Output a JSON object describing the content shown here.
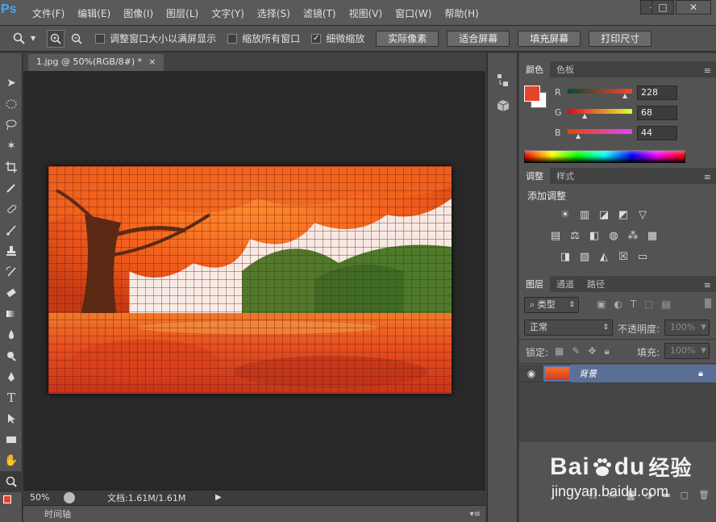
{
  "app": {
    "logo": "Ps"
  },
  "menu": [
    "文件(F)",
    "编辑(E)",
    "图像(I)",
    "图层(L)",
    "文字(Y)",
    "选择(S)",
    "滤镜(T)",
    "视图(V)",
    "窗口(W)",
    "帮助(H)"
  ],
  "window_controls": {
    "minimize": "–",
    "restore": "□",
    "close": "✕"
  },
  "options": {
    "resize_windows": "调整窗口大小以满屏显示",
    "zoom_all": "缩放所有窗口",
    "scrubby_zoom": "细微缩放",
    "scrubby_checked": true,
    "actual_pixels": "实际像素",
    "fit_screen": "适合屏幕",
    "fill_screen": "填充屏幕",
    "print_size": "打印尺寸"
  },
  "document": {
    "tab_title": "1.jpg @ 50%(RGB/8#) *",
    "tab_close": "×"
  },
  "status": {
    "zoom": "50%",
    "doc_info": "文档:1.61M/1.61M"
  },
  "timeline": {
    "label": "时间轴"
  },
  "color_panel": {
    "tabs": [
      "颜色",
      "色板"
    ],
    "fg_color": "#e4442c",
    "bg_color": "#ffffff",
    "r_label": "R",
    "g_label": "G",
    "b_label": "B",
    "r": "228",
    "g": "68",
    "b": "44",
    "r_fraction": 0.894,
    "g_fraction": 0.267,
    "b_fraction": 0.173
  },
  "adjust_panel": {
    "tabs": [
      "调整",
      "样式"
    ],
    "title": "添加调整"
  },
  "layers_panel": {
    "tabs": [
      "图层",
      "通道",
      "路径"
    ],
    "filter": "类型",
    "blend_mode": "正常",
    "opacity_label": "不透明度:",
    "opacity": "100%",
    "lock_label": "锁定:",
    "fill_label": "填充:",
    "fill": "100%",
    "layer_name": "背景"
  },
  "watermark": {
    "brand": "Bai",
    "brand_end": "du",
    "cn": "经验",
    "url": "jingyan.baidu.com"
  }
}
